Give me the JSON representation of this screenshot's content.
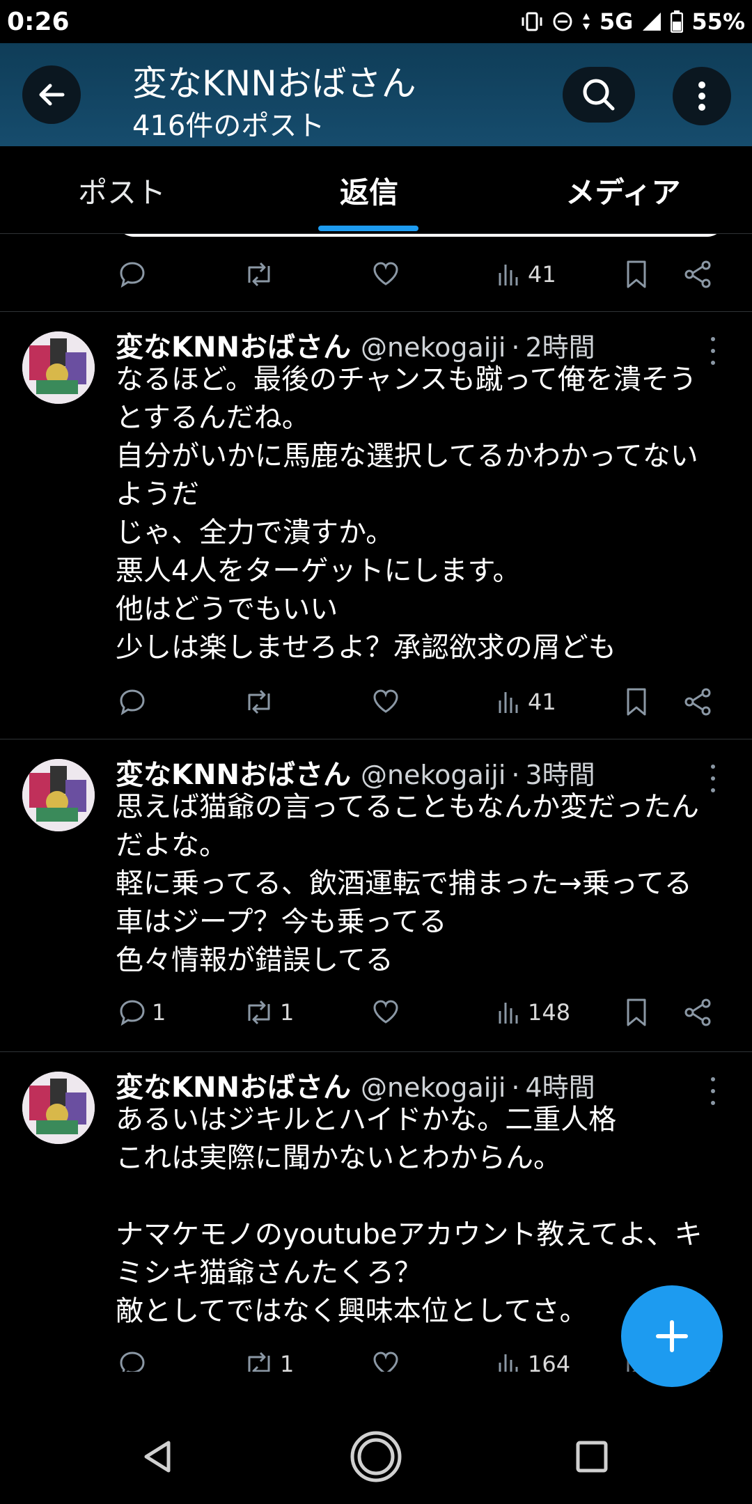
{
  "status_bar": {
    "time": "0:26",
    "network": "5G",
    "battery": "55%"
  },
  "header": {
    "title": "変なKNNおばさん",
    "subtitle": "416件のポスト"
  },
  "tabs": [
    {
      "label": "ポスト"
    },
    {
      "label": "返信",
      "selected": true
    },
    {
      "label": "メディア"
    }
  ],
  "colors": {
    "accent": "#1d9bf0",
    "header_bg": "#164c6d",
    "background": "#000000"
  },
  "top_actions": {
    "views": "41"
  },
  "tweets": [
    {
      "name": "変なKNNおばさん",
      "handle": "@nekogaiji",
      "time": "2時間",
      "lines": [
        "なるほど。最後のチャンスも蹴って俺を潰そう",
        "とするんだね。",
        "自分がいかに馬鹿な選択してるかわかってない",
        "ようだ",
        "じゃ、全力で潰すか。",
        "悪人4人をターゲットにします。",
        "他はどうでもいい",
        "少しは楽しませろよ？承認欲求の屑ども"
      ],
      "replies": "",
      "reposts": "",
      "views": "41"
    },
    {
      "name": "変なKNNおばさん",
      "handle": "@nekogaiji",
      "time": "3時間",
      "lines": [
        "思えば猫爺の言ってることもなんか変だったん",
        "だよな。",
        "軽に乗ってる、飲酒運転で捕まった→乗ってる",
        "車はジープ？今も乗ってる",
        "色々情報が錯誤してる"
      ],
      "replies": "1",
      "reposts": "1",
      "views": "148"
    },
    {
      "name": "変なKNNおばさん",
      "handle": "@nekogaiji",
      "time": "4時間",
      "lines": [
        "あるいはジキルとハイドかな。二重人格",
        "これは実際に聞かないとわからん。",
        "",
        "ナマケモノのyoutubeアカウント教えてよ、キ",
        "ミシキ猫爺さんたくろ？",
        "敵としてではなく興味本位としてさ。"
      ],
      "replies": "",
      "reposts": "1",
      "views": "164"
    }
  ]
}
